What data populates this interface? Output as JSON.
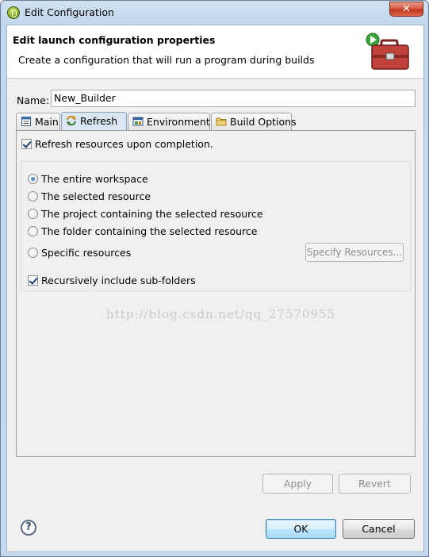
{
  "window": {
    "title": "Edit Configuration",
    "close_glyph": "✕"
  },
  "header": {
    "title": "Edit launch configuration properties",
    "description": "Create a configuration that will run a program during builds"
  },
  "name_field": {
    "label": "Name:",
    "value": "New_Builder"
  },
  "tabs": [
    {
      "label": "Main",
      "icon": "document-icon",
      "active": false
    },
    {
      "label": "Refresh",
      "icon": "refresh-icon",
      "active": true
    },
    {
      "label": "Environment",
      "icon": "environment-icon",
      "active": false
    },
    {
      "label": "Build Options",
      "icon": "folder-icon",
      "active": false
    }
  ],
  "refresh": {
    "refresh_on_completion": {
      "label": "Refresh resources upon completion.",
      "checked": true
    },
    "scope_options": [
      {
        "label": "The entire workspace",
        "selected": true
      },
      {
        "label": "The selected resource",
        "selected": false
      },
      {
        "label": "The project containing the selected resource",
        "selected": false
      },
      {
        "label": "The folder containing the selected resource",
        "selected": false
      },
      {
        "label": "Specific resources",
        "selected": false
      }
    ],
    "specify_resources_label": "Specify Resources...",
    "recursive": {
      "label": "Recursively include sub-folders",
      "checked": true
    }
  },
  "watermark": "http://blog.csdn.net/qq_27570955",
  "buttons": {
    "apply": "Apply",
    "revert": "Revert",
    "ok": "OK",
    "cancel": "Cancel",
    "help_glyph": "?"
  },
  "colors": {
    "title_bar": "#c6d9ee",
    "active_tab": "#dbe6f4",
    "close_button": "#c1371d",
    "default_button": "#bee6fd"
  }
}
